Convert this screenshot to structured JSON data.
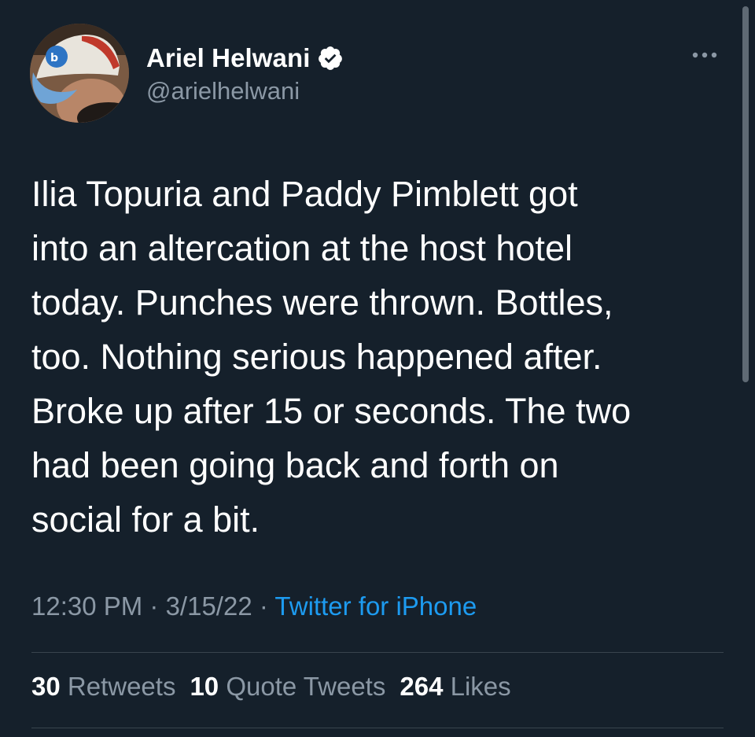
{
  "user": {
    "display_name": "Ariel Helwani",
    "handle": "@arielhelwani",
    "verified": true,
    "avatar_icon": "profile-photo-cap"
  },
  "tweet": {
    "text": "Ilia Topuria and Paddy Pimblett got\ninto an altercation at the host hotel\ntoday. Punches were thrown. Bottles,\ntoo. Nothing serious happened after.\nBroke up after 15 or seconds. The two\nhad been going back and forth on\nsocial for a bit.",
    "time": "12:30 PM",
    "date": "3/15/22",
    "separator": " · ",
    "source": "Twitter for iPhone"
  },
  "stats": {
    "retweets_count": "30",
    "retweets_label": "Retweets",
    "quotes_count": "10",
    "quotes_label": "Quote Tweets",
    "likes_count": "264",
    "likes_label": "Likes"
  },
  "icons": {
    "verified": "verified-badge-icon",
    "more": "more-options-icon"
  },
  "colors": {
    "background": "#15202b",
    "text": "#ffffff",
    "muted": "#8b98a5",
    "accent": "#1d9bf0",
    "divider": "#38444d"
  }
}
